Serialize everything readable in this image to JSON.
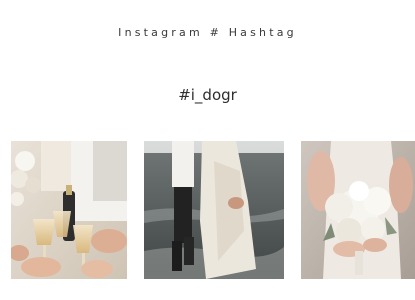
{
  "section": {
    "title": "Instagram # Hashtag",
    "hashtag": "#i_dogr"
  },
  "gallery": {
    "photos": [
      {
        "subject": "champagne-toast-photo"
      },
      {
        "subject": "couple-beach-photo"
      },
      {
        "subject": "bridal-bouquet-photo"
      }
    ]
  },
  "colors": {
    "background": "#ffffff",
    "text": "#333333"
  }
}
